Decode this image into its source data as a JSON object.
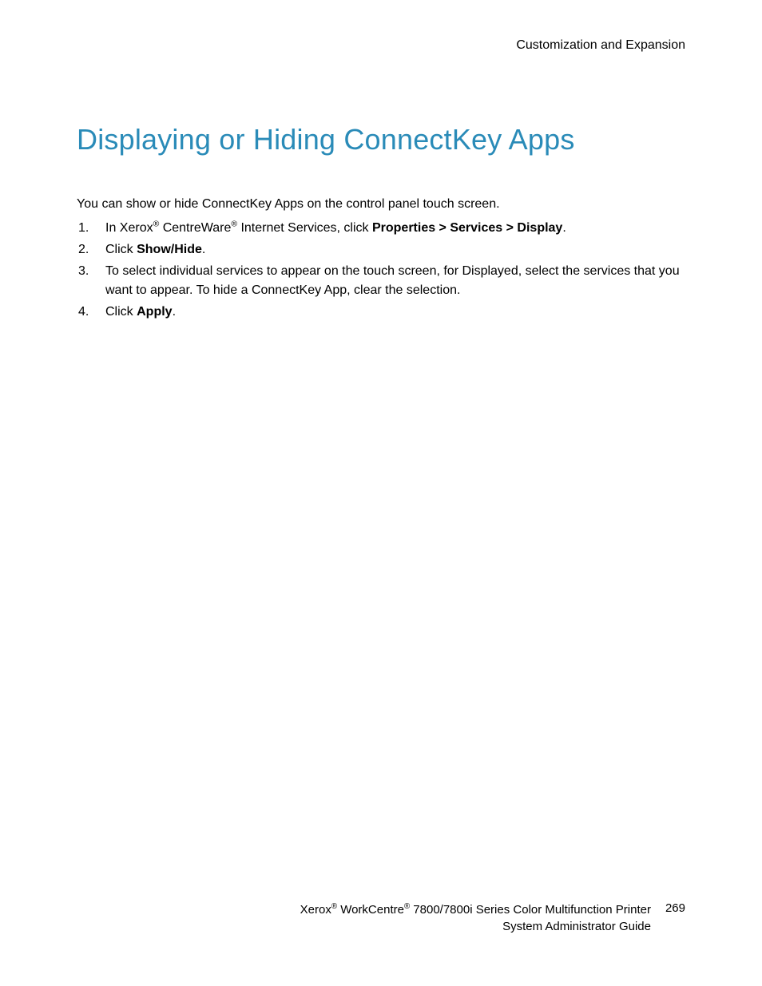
{
  "header": {
    "section": "Customization and Expansion"
  },
  "title": "Displaying or Hiding ConnectKey Apps",
  "intro": "You can show or hide ConnectKey Apps on the control panel touch screen.",
  "steps": {
    "s1": {
      "num": "1.",
      "pre": "In Xerox",
      "mid1": " CentreWare",
      "mid2": " Internet Services, click ",
      "bold": "Properties > Services > Display",
      "end": "."
    },
    "s2": {
      "num": "2.",
      "pre": "Click ",
      "bold": "Show/Hide",
      "end": "."
    },
    "s3": {
      "num": "3.",
      "text": "To select individual services to appear on the touch screen, for Displayed, select the services that you want to appear. To hide a ConnectKey App, clear the selection."
    },
    "s4": {
      "num": "4.",
      "pre": "Click ",
      "bold": "Apply",
      "end": "."
    }
  },
  "footer": {
    "brand1": "Xerox",
    "brand2": " WorkCentre",
    "product": " 7800/7800i Series Color Multifunction Printer",
    "guide": "System Administrator Guide",
    "page": "269"
  },
  "reg": "®"
}
